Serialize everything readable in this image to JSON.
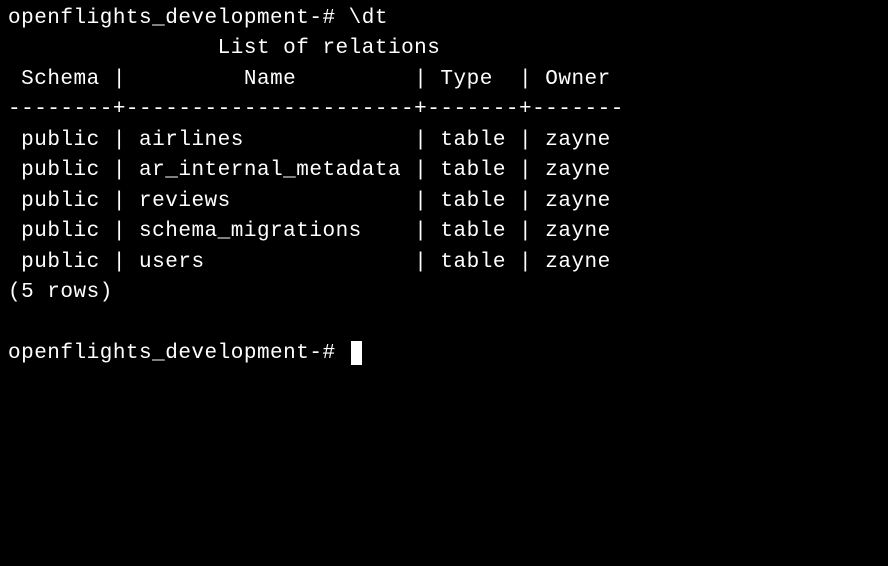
{
  "prompt": "openflights_development-#",
  "command": "\\dt",
  "title": "List of relations",
  "headers": [
    "Schema",
    "Name",
    "Type",
    "Owner"
  ],
  "divider": "--------+----------------------+-------+-------",
  "rows": [
    {
      "schema": "public",
      "name": "airlines",
      "type": "table",
      "owner": "zayne"
    },
    {
      "schema": "public",
      "name": "ar_internal_metadata",
      "type": "table",
      "owner": "zayne"
    },
    {
      "schema": "public",
      "name": "reviews",
      "type": "table",
      "owner": "zayne"
    },
    {
      "schema": "public",
      "name": "schema_migrations",
      "type": "table",
      "owner": "zayne"
    },
    {
      "schema": "public",
      "name": "users",
      "type": "table",
      "owner": "zayne"
    }
  ],
  "row_count": "(5 rows)"
}
